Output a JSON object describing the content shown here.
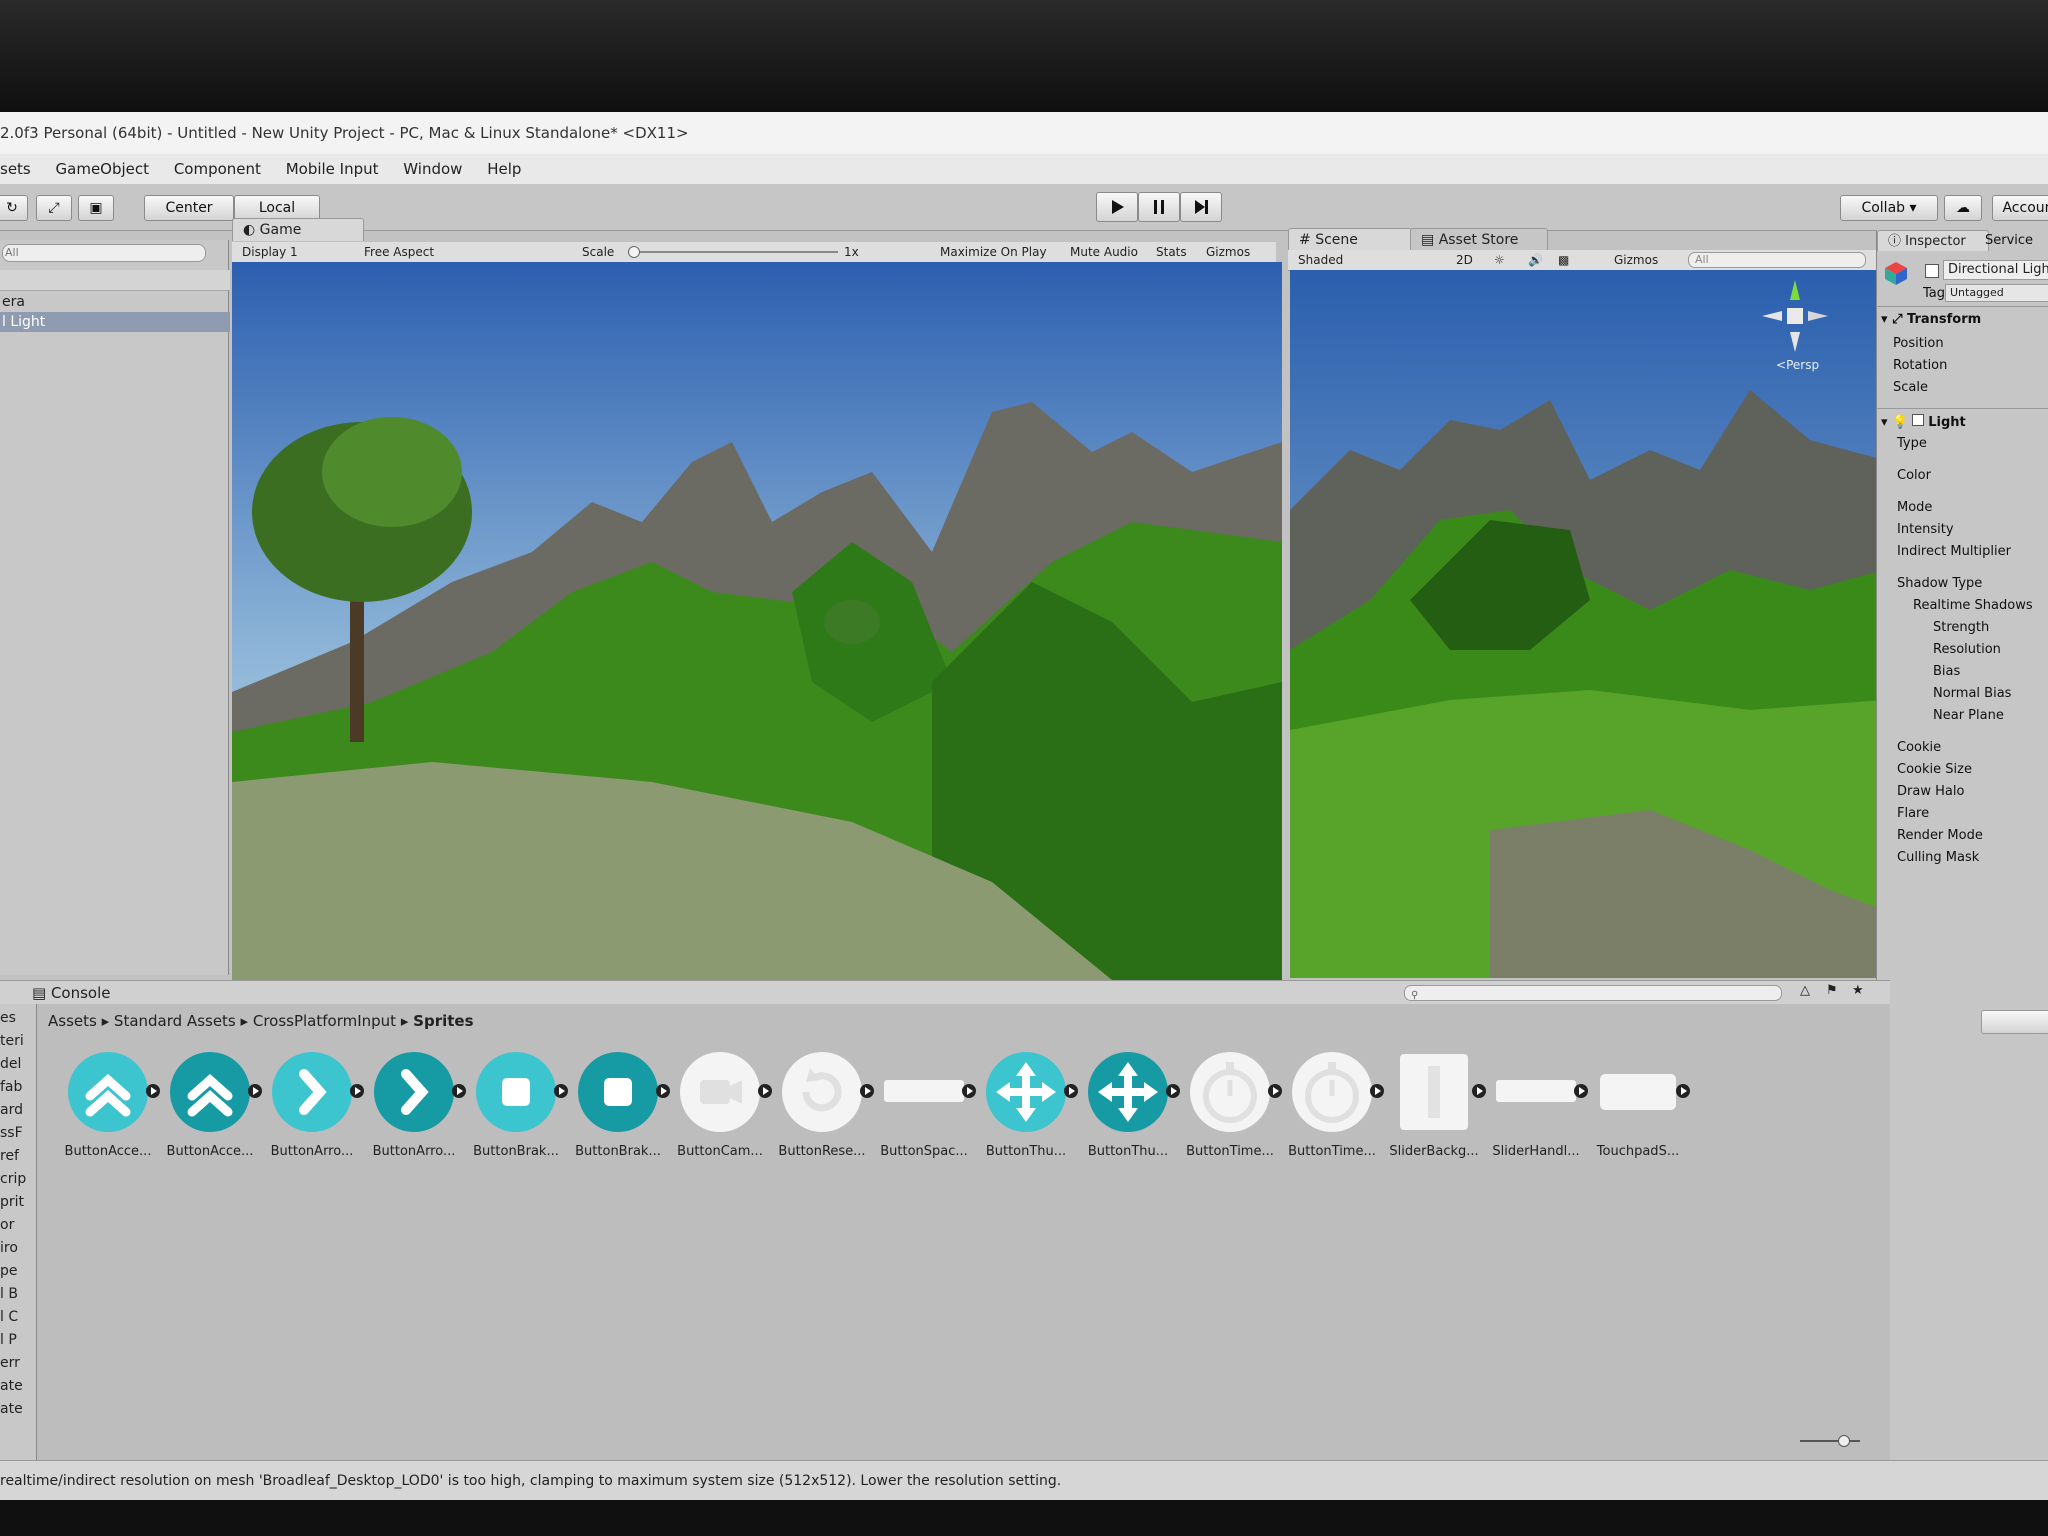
{
  "window": {
    "title": "2.0f3 Personal (64bit) - Untitled - New Unity Project - PC, Mac & Linux Standalone* <DX11>"
  },
  "menu": [
    "sets",
    "GameObject",
    "Component",
    "Mobile Input",
    "Window",
    "Help"
  ],
  "toolbar": {
    "center_label": "Center",
    "local_label": "Local",
    "collab_label": "Collab ▾",
    "account_label": "Accoun"
  },
  "hierarchy": {
    "search_placeholder": "All",
    "items": [
      "era",
      "l Light"
    ]
  },
  "game_view": {
    "tab_label": "Game",
    "display": "Display 1",
    "aspect": "Free Aspect",
    "scale_label": "Scale",
    "scale_value": "1x",
    "scale_fraction": 0.0,
    "maximize_label": "Maximize On Play",
    "mute_label": "Mute Audio",
    "stats_label": "Stats",
    "gizmos_label": "Gizmos"
  },
  "scene_view": {
    "tab_label": "Scene",
    "asset_store_label": "Asset Store",
    "shading": "Shaded",
    "mode_2d": "2D",
    "gizmos_label": "Gizmos",
    "search_placeholder": "All",
    "persp_label": "Persp"
  },
  "inspector": {
    "tab_label": "Inspector",
    "services_label": "Service",
    "object_name": "Directional Ligh",
    "tag_label": "Tag",
    "tag_value": "Untagged",
    "transform_title": "Transform",
    "transform_fields": [
      "Position",
      "Rotation",
      "Scale"
    ],
    "light_title": "Light",
    "light_fields": [
      "Type",
      "Color",
      "Mode",
      "Intensity",
      "Indirect Multiplier",
      "Shadow Type",
      "Realtime Shadows",
      "Strength",
      "Resolution",
      "Bias",
      "Normal Bias",
      "Near Plane",
      "Cookie",
      "Cookie Size",
      "Draw Halo",
      "Flare",
      "Render Mode",
      "Culling Mask"
    ]
  },
  "console": {
    "tab_label": "Console"
  },
  "project": {
    "breadcrumb": [
      "Assets",
      "Standard Assets",
      "CrossPlatformInput",
      "Sprites"
    ],
    "left_items": [
      "es",
      "teri",
      "del",
      "fab",
      "ard",
      "ssF",
      "ref",
      "crip",
      "prit",
      "or",
      "iro",
      "pe",
      "l B",
      "l C",
      "l P",
      "err",
      "ate",
      "ate"
    ],
    "assets": [
      {
        "name": "ButtonAcce...",
        "icon": "double-chevron-up-icon",
        "style": "light"
      },
      {
        "name": "ButtonAcce...",
        "icon": "double-chevron-up-icon",
        "style": "dark"
      },
      {
        "name": "ButtonArro...",
        "icon": "chevron-right-icon",
        "style": "light"
      },
      {
        "name": "ButtonArro...",
        "icon": "chevron-right-icon",
        "style": "dark"
      },
      {
        "name": "ButtonBrak...",
        "icon": "stop-square-icon",
        "style": "light"
      },
      {
        "name": "ButtonBrak...",
        "icon": "stop-square-icon",
        "style": "dark"
      },
      {
        "name": "ButtonCam...",
        "icon": "camera-icon",
        "style": "white"
      },
      {
        "name": "ButtonRese...",
        "icon": "reset-arrow-icon",
        "style": "white"
      },
      {
        "name": "ButtonSpac...",
        "icon": "space-bar-icon",
        "style": "bar"
      },
      {
        "name": "ButtonThu...",
        "icon": "move-arrows-icon",
        "style": "light"
      },
      {
        "name": "ButtonThu...",
        "icon": "move-arrows-icon",
        "style": "dark"
      },
      {
        "name": "ButtonTime...",
        "icon": "stopwatch-icon",
        "style": "white"
      },
      {
        "name": "ButtonTime...",
        "icon": "stopwatch-icon",
        "style": "white"
      },
      {
        "name": "SliderBackg...",
        "icon": "slider-background-icon",
        "style": "slider-bg"
      },
      {
        "name": "SliderHandl...",
        "icon": "slider-handle-icon",
        "style": "bar"
      },
      {
        "name": "TouchpadS...",
        "icon": "touchpad-icon",
        "style": "pad"
      }
    ]
  },
  "status": {
    "message": "realtime/indirect resolution on mesh 'Broadleaf_Desktop_LOD0' is too high, clamping to maximum system size (512x512). Lower the resolution setting."
  },
  "colors": {
    "teal_light": "#3cc4cf",
    "teal_dark": "#169aa3",
    "sky_top": "#2c5fb0",
    "sky_bottom": "#b7d3e6",
    "grass": "#3d8a1c"
  }
}
